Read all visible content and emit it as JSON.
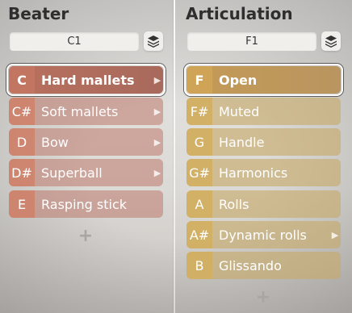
{
  "beater": {
    "title": "Beater",
    "selected_note": "C1",
    "items": [
      {
        "note": "C",
        "label": "Hard mallets",
        "has_submenu": true,
        "active": true
      },
      {
        "note": "C#",
        "label": "Soft mallets",
        "has_submenu": true,
        "active": false
      },
      {
        "note": "D",
        "label": "Bow",
        "has_submenu": true,
        "active": false
      },
      {
        "note": "D#",
        "label": "Superball",
        "has_submenu": true,
        "active": false
      },
      {
        "note": "E",
        "label": "Rasping stick",
        "has_submenu": false,
        "active": false
      }
    ],
    "add_label": "+"
  },
  "articulation": {
    "title": "Articulation",
    "selected_note": "F1",
    "items": [
      {
        "note": "F",
        "label": "Open",
        "has_submenu": false,
        "active": true
      },
      {
        "note": "F#",
        "label": "Muted",
        "has_submenu": false,
        "active": false
      },
      {
        "note": "G",
        "label": "Handle",
        "has_submenu": false,
        "active": false
      },
      {
        "note": "G#",
        "label": "Harmonics",
        "has_submenu": false,
        "active": false
      },
      {
        "note": "A",
        "label": "Rolls",
        "has_submenu": false,
        "active": false
      },
      {
        "note": "A#",
        "label": "Dynamic rolls",
        "has_submenu": true,
        "active": false
      },
      {
        "note": "B",
        "label": "Glissando",
        "has_submenu": false,
        "active": false
      }
    ],
    "add_label": "+"
  },
  "colors": {
    "beater_accent": "#c27561",
    "articulation_accent": "#cfa457"
  },
  "icons": {
    "stack": "layers-icon",
    "submenu": "chevron-right-icon",
    "add": "plus-icon"
  }
}
